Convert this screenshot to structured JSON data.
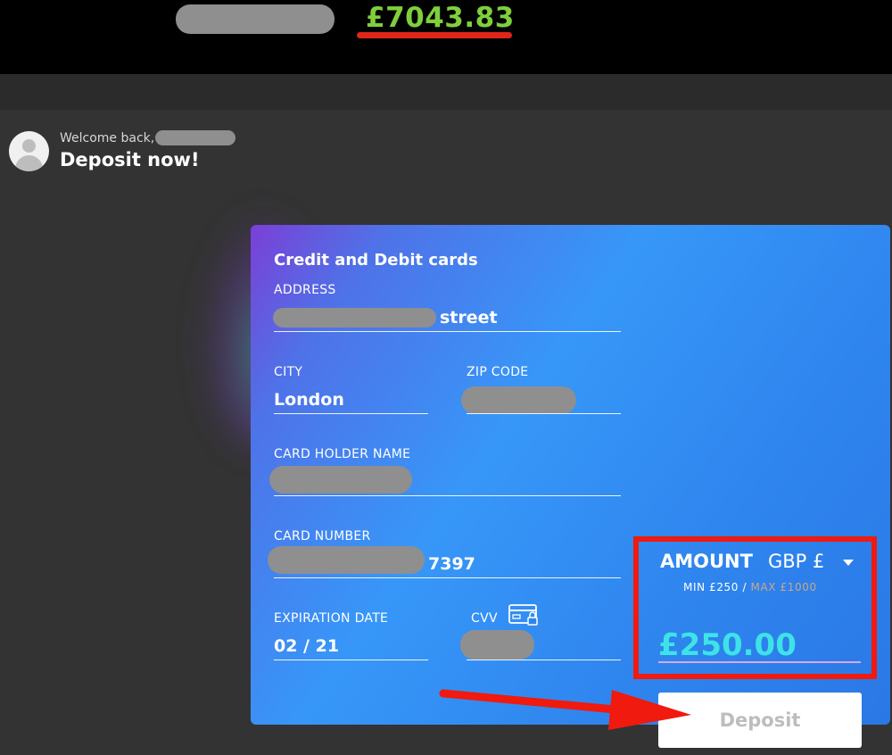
{
  "header": {
    "balance": "£7043.83"
  },
  "greeting": {
    "welcome": "Welcome back,",
    "title": "Deposit now!"
  },
  "card": {
    "title": "Credit and Debit cards",
    "address_label": "ADDRESS",
    "address_value": "street",
    "city_label": "CITY",
    "city_value": "London",
    "zip_label": "ZIP CODE",
    "holder_label": "CARD HOLDER NAME",
    "number_label": "CARD NUMBER",
    "number_value": "7397",
    "expiration_label": "EXPIRATION DATE",
    "expiration_value": "02 / 21",
    "cvv_label": "CVV"
  },
  "amount": {
    "heading": "AMOUNT",
    "currency": "GBP £",
    "min": "MIN £250",
    "separator": " / ",
    "max": "MAX £1000",
    "value": "£250.00"
  },
  "deposit_button": "Deposit",
  "colors": {
    "balance": "#7fcf3d",
    "highlight": "#f01a0f",
    "amount": "#3de3e6"
  }
}
